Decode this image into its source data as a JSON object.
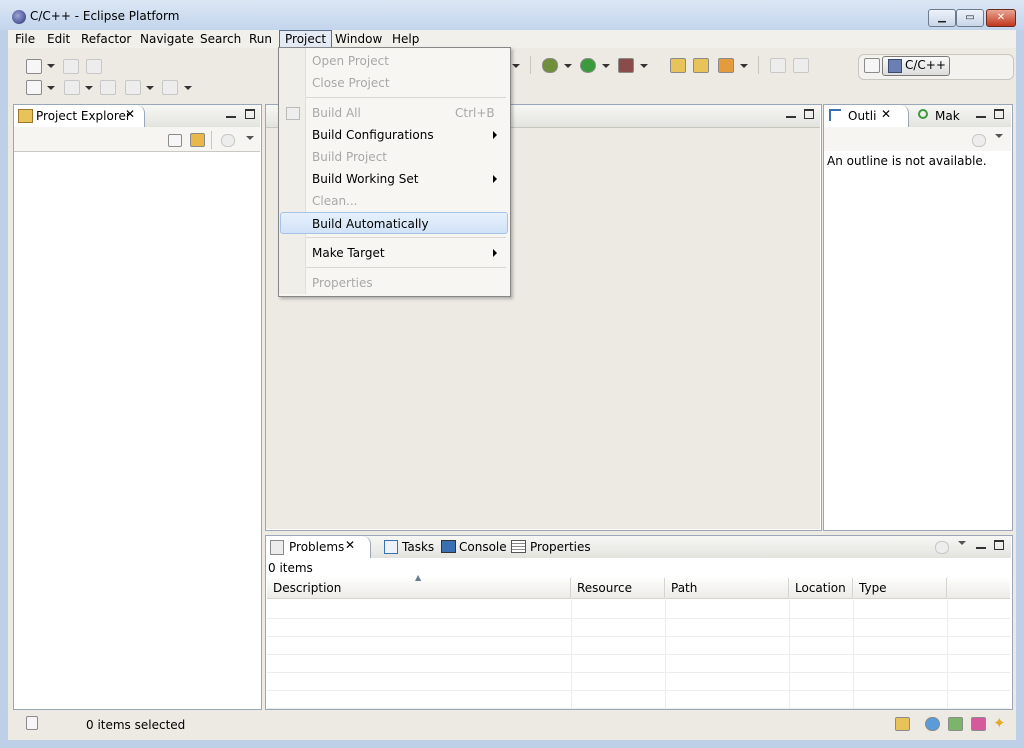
{
  "window": {
    "title": "C/C++ - Eclipse Platform"
  },
  "menubar": [
    "File",
    "Edit",
    "Refactor",
    "Navigate",
    "Search",
    "Run",
    "Project",
    "Window",
    "Help"
  ],
  "project_menu": {
    "items": [
      {
        "label": "Open Project",
        "enabled": false
      },
      {
        "label": "Close Project",
        "enabled": false
      },
      {
        "label": "Build All",
        "accel": "Ctrl+B",
        "enabled": false
      },
      {
        "label": "Build Configurations",
        "submenu": true,
        "enabled": true
      },
      {
        "label": "Build Project",
        "enabled": false
      },
      {
        "label": "Build Working Set",
        "submenu": true,
        "enabled": true
      },
      {
        "label": "Clean...",
        "enabled": false
      },
      {
        "label": "Build Automatically",
        "enabled": true,
        "highlighted": true
      },
      {
        "label": "Make Target",
        "submenu": true,
        "enabled": true
      },
      {
        "label": "Properties",
        "enabled": false
      }
    ]
  },
  "perspective": {
    "label": "C/C++"
  },
  "project_explorer": {
    "tab": "Project Explorer"
  },
  "outline": {
    "tab": "Outli",
    "tab2": "Mak",
    "message": "An outline is not available."
  },
  "bottom": {
    "tabs": [
      "Problems",
      "Tasks",
      "Console",
      "Properties"
    ],
    "count": "0 items",
    "columns": [
      "Description",
      "Resource",
      "Path",
      "Location",
      "Type"
    ]
  },
  "status": {
    "text": "0 items selected"
  }
}
